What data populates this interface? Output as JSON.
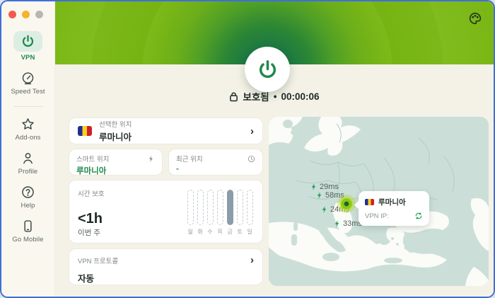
{
  "colors": {
    "accent_green": "#1e8a4d",
    "lime": "#a4d70b",
    "hero_dark_green": "#156f47",
    "map_land": "#cbdfd8",
    "map_sea": "#fbfbf7",
    "bar_filled": "#8c9da9",
    "traffic_red": "#f5594e",
    "traffic_yellow": "#f5b32f",
    "traffic_gray": "#b9b7b4"
  },
  "sidebar": {
    "items": [
      {
        "id": "vpn",
        "label": "VPN",
        "icon": "power-icon",
        "active": true
      },
      {
        "id": "speed-test",
        "label": "Speed Test",
        "icon": "speedometer-icon",
        "active": false
      },
      {
        "id": "add-ons",
        "label": "Add-ons",
        "icon": "star-icon",
        "active": false
      },
      {
        "id": "profile",
        "label": "Profile",
        "icon": "person-icon",
        "active": false
      },
      {
        "id": "help",
        "label": "Help",
        "icon": "question-icon",
        "active": false
      },
      {
        "id": "go-mobile",
        "label": "Go Mobile",
        "icon": "phone-icon",
        "active": false
      }
    ]
  },
  "header": {
    "theme_icon": "palette-icon",
    "power_button_icon": "power-icon",
    "status_icon": "lock-icon",
    "status_label": "보호됨",
    "separator": "•",
    "timer": "00:00:06"
  },
  "cards": {
    "selected_location": {
      "label": "선택한 위치",
      "value": "루마니아",
      "flag": "romania-flag",
      "chevron": "›"
    },
    "smart_location": {
      "label": "스마트 위치",
      "value": "루마니아",
      "icon": "spark-icon"
    },
    "recent_location": {
      "label": "최근 위치",
      "value": "-",
      "icon": "clock-icon"
    },
    "time_protected": {
      "label": "시간 보호",
      "value": "<1h",
      "sublabel": "이번 주"
    },
    "vpn_protocol": {
      "label": "VPN 프로토콜",
      "value": "자동",
      "chevron": "›"
    }
  },
  "chart_data": {
    "type": "bar",
    "title": "시간 보호",
    "categories": [
      "월",
      "화",
      "수",
      "목",
      "금",
      "토",
      "일"
    ],
    "values": [
      0,
      0,
      0,
      0,
      1,
      0,
      0
    ],
    "summary_value": "<1h",
    "summary_period": "이번 주",
    "note": "dashed outline = no usage, filled = active day"
  },
  "map": {
    "pings": [
      {
        "value": "29ms",
        "icon": "bolt-icon"
      },
      {
        "value": "58ms",
        "icon": "bolt-icon"
      },
      {
        "value": "24ms",
        "icon": "bolt-icon"
      },
      {
        "value": "33ms",
        "icon": "bolt-icon"
      }
    ],
    "tooltip": {
      "country": "루마니아",
      "flag": "romania-flag",
      "ip_label": "VPN IP:",
      "refresh_icon": "refresh-icon"
    },
    "connected_marker": "connected-dot"
  }
}
